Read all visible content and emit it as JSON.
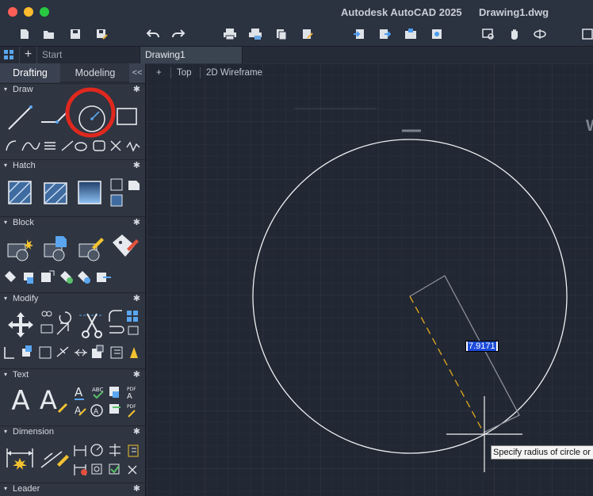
{
  "window": {
    "app_title": "Autodesk AutoCAD 2025",
    "doc_title": "Drawing1.dwg",
    "dots": [
      "#ff5f57",
      "#febc2e",
      "#28c840"
    ]
  },
  "toolbar": {
    "icons": [
      "new-icon",
      "open-icon",
      "save-icon",
      "save-as-icon",
      "undo-icon",
      "redo-icon",
      "plot-icon",
      "plot-preview-icon",
      "publish-icon",
      "batch-plot-icon",
      "import-icon",
      "export-icon",
      "share-icon",
      "cloud-icon",
      "zoom-window-icon",
      "pan-icon",
      "orbit-icon"
    ]
  },
  "tabs": {
    "start": "Start",
    "drawing": "Drawing1"
  },
  "palette": {
    "tab_drafting": "Drafting",
    "tab_modeling": "Modeling",
    "collapse": "<<",
    "sections": {
      "draw": "Draw",
      "hatch": "Hatch",
      "block": "Block",
      "modify": "Modify",
      "text": "Text",
      "dimension": "Dimension",
      "leader": "Leader"
    },
    "highlight_color": "#e0281e"
  },
  "viewport": {
    "plus": "+",
    "view": "Top",
    "visual_style": "2D Wireframe",
    "radius_value": "7.9171",
    "tooltip": "Specify radius of circle or",
    "edge_letter": "W",
    "accent_dash": "#d9a21f"
  }
}
